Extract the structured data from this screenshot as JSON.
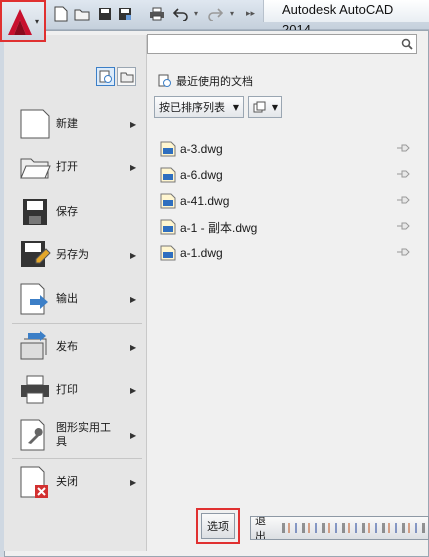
{
  "titlebar": {
    "app_title": "Autodesk AutoCAD 2014",
    "quick_access": [
      "new-icon",
      "open-icon",
      "save-icon",
      "save-as-icon",
      "print-icon",
      "undo-icon",
      "redo-icon"
    ]
  },
  "sidebar": {
    "items": [
      {
        "label": "新建",
        "icon": "new-document-icon",
        "has_submenu": true
      },
      {
        "label": "打开",
        "icon": "open-folder-icon",
        "has_submenu": true
      },
      {
        "label": "保存",
        "icon": "floppy-save-icon",
        "has_submenu": false
      },
      {
        "label": "另存为",
        "icon": "save-as-icon",
        "has_submenu": true
      },
      {
        "label": "输出",
        "icon": "export-icon",
        "has_submenu": true
      },
      {
        "label": "发布",
        "icon": "publish-icon",
        "has_submenu": true
      },
      {
        "label": "打印",
        "icon": "printer-icon",
        "has_submenu": true
      },
      {
        "label": "图形实用工具",
        "icon": "wrench-icon",
        "has_submenu": true
      },
      {
        "label": "关闭",
        "icon": "close-document-icon",
        "has_submenu": true
      }
    ]
  },
  "search": {
    "placeholder": ""
  },
  "recent": {
    "title": "最近使用的文档",
    "sort_label": "按已排序列表",
    "files": [
      "a-3.dwg",
      "a-6.dwg",
      "a-41.dwg",
      "a-1 - 副本.dwg",
      "a-1.dwg"
    ]
  },
  "footer": {
    "options_label": "选项",
    "exit_label": "退出"
  },
  "colors": {
    "accent_red": "#e03030",
    "autocad_red": "#c8102e"
  }
}
